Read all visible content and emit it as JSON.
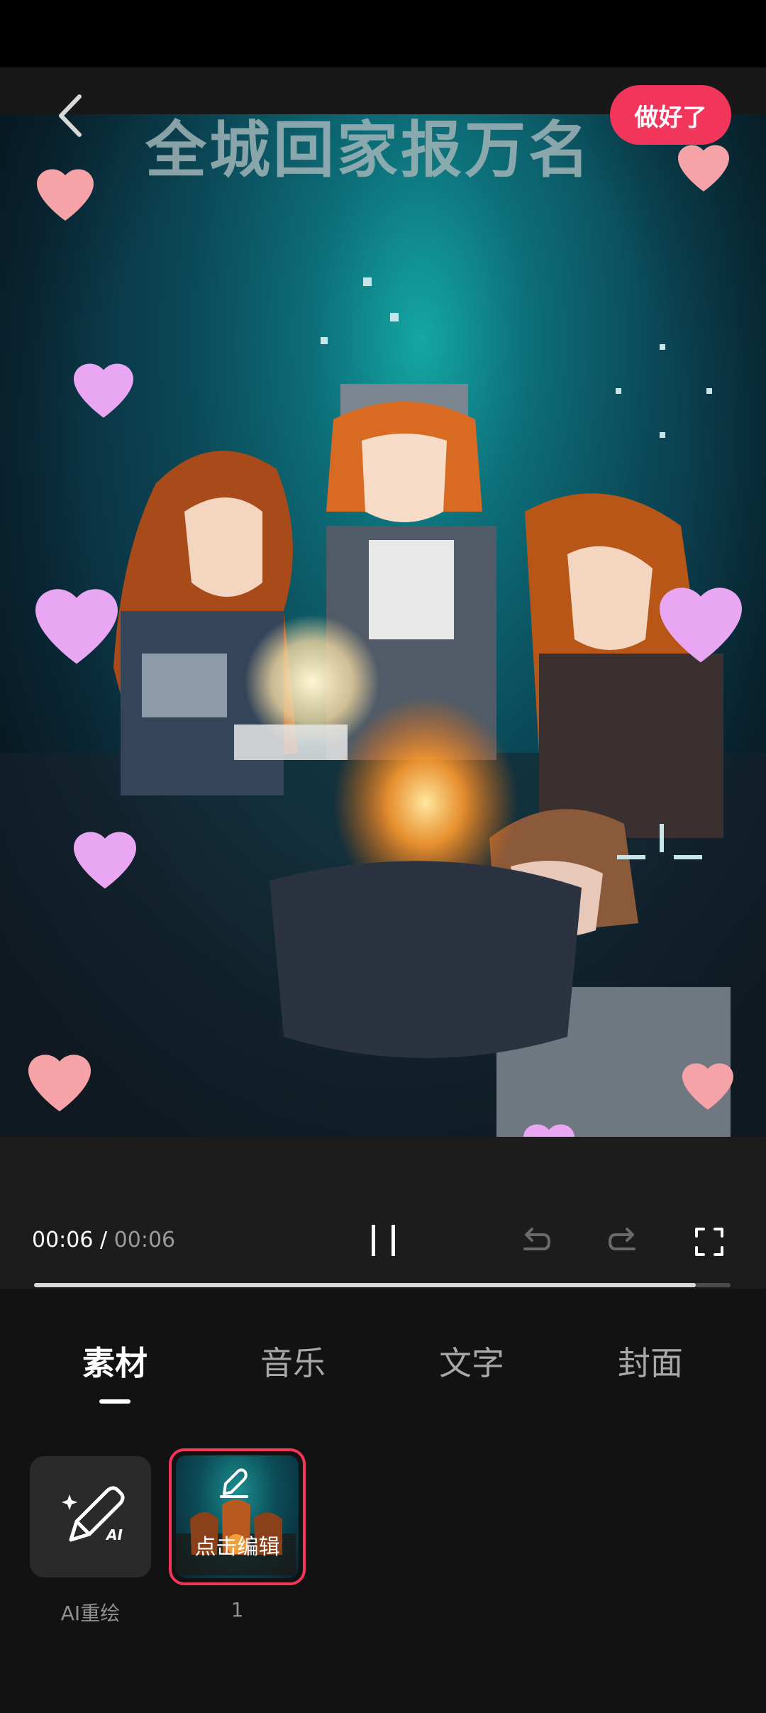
{
  "header": {
    "done_label": "做好了"
  },
  "preview": {
    "title_pixel_text": "全城回家报万名"
  },
  "player": {
    "current_time": "00:06",
    "separator": " / ",
    "total_time": "00:06",
    "progress": 0.95
  },
  "tabs": [
    {
      "label": "素材",
      "active": true
    },
    {
      "label": "音乐",
      "active": false
    },
    {
      "label": "文字",
      "active": false
    },
    {
      "label": "封面",
      "active": false
    }
  ],
  "tools": {
    "ai_redraw": {
      "badge": "AI",
      "label": "AI重绘"
    },
    "clip": {
      "edit_label": "点击编辑",
      "index_label": "1"
    }
  },
  "colors": {
    "accent": "#f2355b",
    "background": "#121212",
    "heart_pink": "#f6a3a8",
    "heart_purple": "#e9a6f2"
  }
}
